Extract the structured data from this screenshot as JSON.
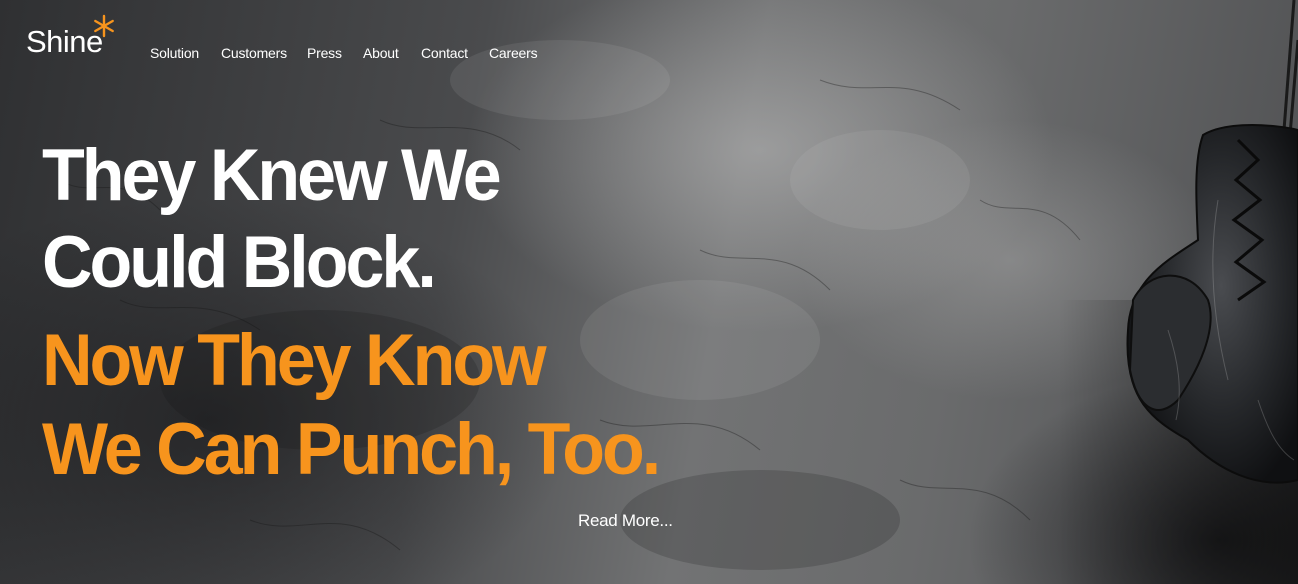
{
  "brand": {
    "name": "Shine",
    "accent_color": "#f7941d",
    "logo_mark": "asterisk-icon"
  },
  "nav": {
    "items": [
      {
        "label": "Solution"
      },
      {
        "label": "Customers"
      },
      {
        "label": "Press"
      },
      {
        "label": "About"
      },
      {
        "label": "Contact"
      },
      {
        "label": "Careers"
      }
    ]
  },
  "hero": {
    "headline_white": [
      "They Knew We",
      "Could Block."
    ],
    "headline_orange": [
      "Now They Know",
      "We Can Punch, Too."
    ],
    "read_more": "Read More...",
    "image": "boxing-glove-image"
  }
}
